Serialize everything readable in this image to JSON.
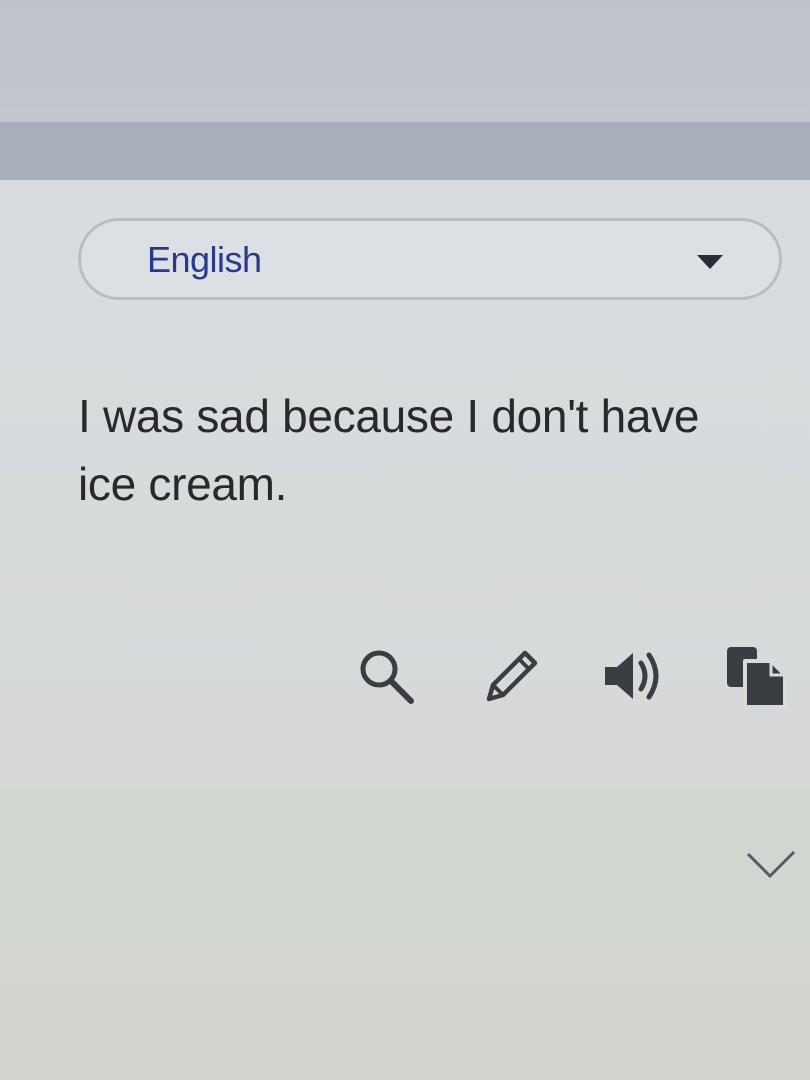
{
  "language_selector": {
    "selected": "English",
    "icon": "dropdown-triangle-icon"
  },
  "result": {
    "text": "I was sad because I don't have ice cream."
  },
  "actions": [
    {
      "name": "search",
      "icon": "search-icon"
    },
    {
      "name": "edit",
      "icon": "pencil-icon"
    },
    {
      "name": "listen",
      "icon": "speaker-icon"
    },
    {
      "name": "copy",
      "icon": "copy-icon"
    }
  ],
  "expand": {
    "icon": "chevron-down-icon"
  },
  "colors": {
    "language_text": "#283a8c",
    "body_text": "#27292d",
    "icon": "#3a3d42",
    "header_band": "#a9aebb"
  }
}
